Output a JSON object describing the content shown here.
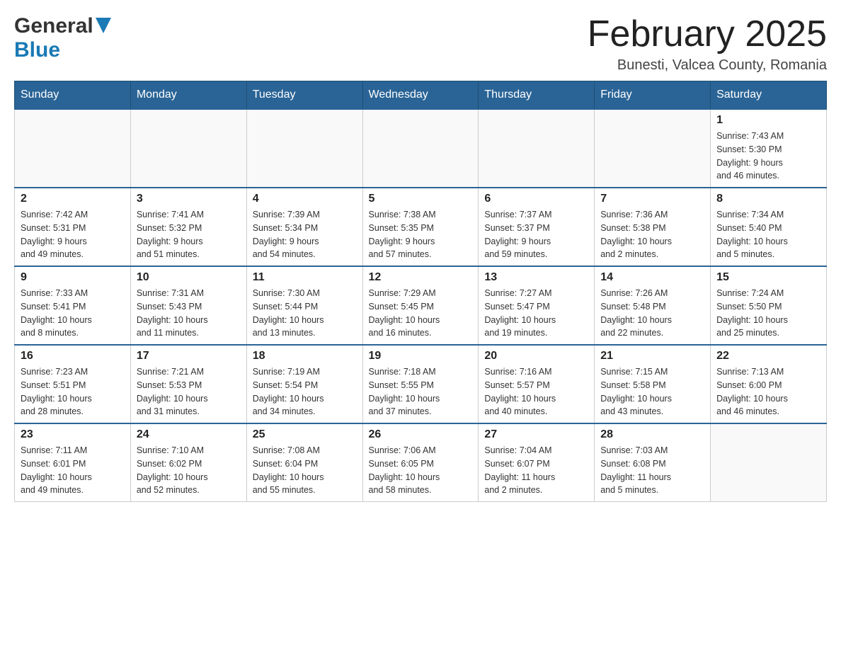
{
  "header": {
    "logo_general": "General",
    "logo_blue": "Blue",
    "month_title": "February 2025",
    "location": "Bunesti, Valcea County, Romania"
  },
  "days_of_week": [
    "Sunday",
    "Monday",
    "Tuesday",
    "Wednesday",
    "Thursday",
    "Friday",
    "Saturday"
  ],
  "weeks": [
    [
      {
        "day": "",
        "info": ""
      },
      {
        "day": "",
        "info": ""
      },
      {
        "day": "",
        "info": ""
      },
      {
        "day": "",
        "info": ""
      },
      {
        "day": "",
        "info": ""
      },
      {
        "day": "",
        "info": ""
      },
      {
        "day": "1",
        "info": "Sunrise: 7:43 AM\nSunset: 5:30 PM\nDaylight: 9 hours\nand 46 minutes."
      }
    ],
    [
      {
        "day": "2",
        "info": "Sunrise: 7:42 AM\nSunset: 5:31 PM\nDaylight: 9 hours\nand 49 minutes."
      },
      {
        "day": "3",
        "info": "Sunrise: 7:41 AM\nSunset: 5:32 PM\nDaylight: 9 hours\nand 51 minutes."
      },
      {
        "day": "4",
        "info": "Sunrise: 7:39 AM\nSunset: 5:34 PM\nDaylight: 9 hours\nand 54 minutes."
      },
      {
        "day": "5",
        "info": "Sunrise: 7:38 AM\nSunset: 5:35 PM\nDaylight: 9 hours\nand 57 minutes."
      },
      {
        "day": "6",
        "info": "Sunrise: 7:37 AM\nSunset: 5:37 PM\nDaylight: 9 hours\nand 59 minutes."
      },
      {
        "day": "7",
        "info": "Sunrise: 7:36 AM\nSunset: 5:38 PM\nDaylight: 10 hours\nand 2 minutes."
      },
      {
        "day": "8",
        "info": "Sunrise: 7:34 AM\nSunset: 5:40 PM\nDaylight: 10 hours\nand 5 minutes."
      }
    ],
    [
      {
        "day": "9",
        "info": "Sunrise: 7:33 AM\nSunset: 5:41 PM\nDaylight: 10 hours\nand 8 minutes."
      },
      {
        "day": "10",
        "info": "Sunrise: 7:31 AM\nSunset: 5:43 PM\nDaylight: 10 hours\nand 11 minutes."
      },
      {
        "day": "11",
        "info": "Sunrise: 7:30 AM\nSunset: 5:44 PM\nDaylight: 10 hours\nand 13 minutes."
      },
      {
        "day": "12",
        "info": "Sunrise: 7:29 AM\nSunset: 5:45 PM\nDaylight: 10 hours\nand 16 minutes."
      },
      {
        "day": "13",
        "info": "Sunrise: 7:27 AM\nSunset: 5:47 PM\nDaylight: 10 hours\nand 19 minutes."
      },
      {
        "day": "14",
        "info": "Sunrise: 7:26 AM\nSunset: 5:48 PM\nDaylight: 10 hours\nand 22 minutes."
      },
      {
        "day": "15",
        "info": "Sunrise: 7:24 AM\nSunset: 5:50 PM\nDaylight: 10 hours\nand 25 minutes."
      }
    ],
    [
      {
        "day": "16",
        "info": "Sunrise: 7:23 AM\nSunset: 5:51 PM\nDaylight: 10 hours\nand 28 minutes."
      },
      {
        "day": "17",
        "info": "Sunrise: 7:21 AM\nSunset: 5:53 PM\nDaylight: 10 hours\nand 31 minutes."
      },
      {
        "day": "18",
        "info": "Sunrise: 7:19 AM\nSunset: 5:54 PM\nDaylight: 10 hours\nand 34 minutes."
      },
      {
        "day": "19",
        "info": "Sunrise: 7:18 AM\nSunset: 5:55 PM\nDaylight: 10 hours\nand 37 minutes."
      },
      {
        "day": "20",
        "info": "Sunrise: 7:16 AM\nSunset: 5:57 PM\nDaylight: 10 hours\nand 40 minutes."
      },
      {
        "day": "21",
        "info": "Sunrise: 7:15 AM\nSunset: 5:58 PM\nDaylight: 10 hours\nand 43 minutes."
      },
      {
        "day": "22",
        "info": "Sunrise: 7:13 AM\nSunset: 6:00 PM\nDaylight: 10 hours\nand 46 minutes."
      }
    ],
    [
      {
        "day": "23",
        "info": "Sunrise: 7:11 AM\nSunset: 6:01 PM\nDaylight: 10 hours\nand 49 minutes."
      },
      {
        "day": "24",
        "info": "Sunrise: 7:10 AM\nSunset: 6:02 PM\nDaylight: 10 hours\nand 52 minutes."
      },
      {
        "day": "25",
        "info": "Sunrise: 7:08 AM\nSunset: 6:04 PM\nDaylight: 10 hours\nand 55 minutes."
      },
      {
        "day": "26",
        "info": "Sunrise: 7:06 AM\nSunset: 6:05 PM\nDaylight: 10 hours\nand 58 minutes."
      },
      {
        "day": "27",
        "info": "Sunrise: 7:04 AM\nSunset: 6:07 PM\nDaylight: 11 hours\nand 2 minutes."
      },
      {
        "day": "28",
        "info": "Sunrise: 7:03 AM\nSunset: 6:08 PM\nDaylight: 11 hours\nand 5 minutes."
      },
      {
        "day": "",
        "info": ""
      }
    ]
  ]
}
